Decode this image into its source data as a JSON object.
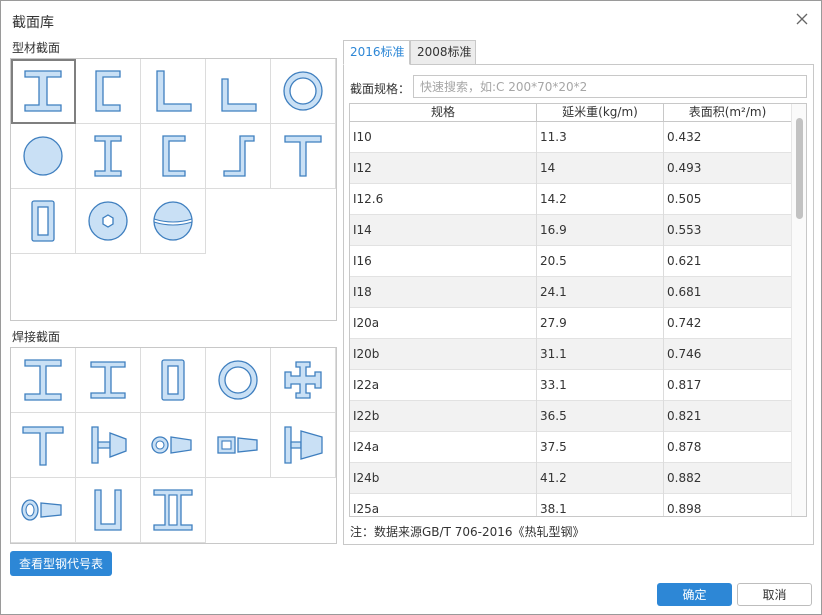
{
  "dialog": {
    "title": "截面库",
    "close_icon": "close-icon"
  },
  "profile_section": {
    "label": "型材截面",
    "items": [
      {
        "icon": "i-beam-icon",
        "selected": true
      },
      {
        "icon": "channel-icon"
      },
      {
        "icon": "equal-angle-icon"
      },
      {
        "icon": "unequal-angle-icon"
      },
      {
        "icon": "pipe-icon"
      },
      {
        "icon": "round-bar-icon"
      },
      {
        "icon": "light-i-beam-icon"
      },
      {
        "icon": "light-channel-icon"
      },
      {
        "icon": "z-section-icon"
      },
      {
        "icon": "t-section-icon"
      },
      {
        "icon": "rectangular-tube-icon"
      },
      {
        "icon": "hexagon-bar-icon"
      },
      {
        "icon": "split-round-icon"
      }
    ]
  },
  "welded_section": {
    "label": "焊接截面",
    "items": [
      {
        "icon": "welded-i-beam-icon"
      },
      {
        "icon": "welded-h-beam-icon"
      },
      {
        "icon": "welded-box-icon"
      },
      {
        "icon": "welded-pipe-icon"
      },
      {
        "icon": "welded-cross-icon"
      },
      {
        "icon": "welded-t-icon"
      },
      {
        "icon": "tapered-i-icon"
      },
      {
        "icon": "tapered-pipe-icon"
      },
      {
        "icon": "tapered-box-icon"
      },
      {
        "icon": "tapered-h-icon"
      },
      {
        "icon": "tapered-ellipse-icon"
      },
      {
        "icon": "u-section-icon"
      },
      {
        "icon": "double-channel-icon"
      }
    ]
  },
  "code_table_button": "查看型钢代号表",
  "tabs": [
    {
      "label": "2016标准",
      "active": true
    },
    {
      "label": "2008标准",
      "active": false
    }
  ],
  "search": {
    "label": "截面规格：",
    "placeholder": "快速搜索，如:C 200*70*20*2",
    "value": ""
  },
  "table": {
    "headers": [
      "规格",
      "延米重(kg/m)",
      "表面积(m²/m)"
    ],
    "rows": [
      [
        "I10",
        "11.3",
        "0.432"
      ],
      [
        "I12",
        "14",
        "0.493"
      ],
      [
        "I12.6",
        "14.2",
        "0.505"
      ],
      [
        "I14",
        "16.9",
        "0.553"
      ],
      [
        "I16",
        "20.5",
        "0.621"
      ],
      [
        "I18",
        "24.1",
        "0.681"
      ],
      [
        "I20a",
        "27.9",
        "0.742"
      ],
      [
        "I20b",
        "31.1",
        "0.746"
      ],
      [
        "I22a",
        "33.1",
        "0.817"
      ],
      [
        "I22b",
        "36.5",
        "0.821"
      ],
      [
        "I24a",
        "37.5",
        "0.878"
      ],
      [
        "I24b",
        "41.2",
        "0.882"
      ],
      [
        "I25a",
        "38.1",
        "0.898"
      ]
    ]
  },
  "note": "注：数据来源GB/T 706-2016《热轧型钢》",
  "footer": {
    "ok_label": "确定",
    "cancel_label": "取消"
  },
  "colors": {
    "accent": "#2d87d6",
    "shape_fill": "#c9e0f5",
    "shape_stroke": "#3f7fbf"
  }
}
